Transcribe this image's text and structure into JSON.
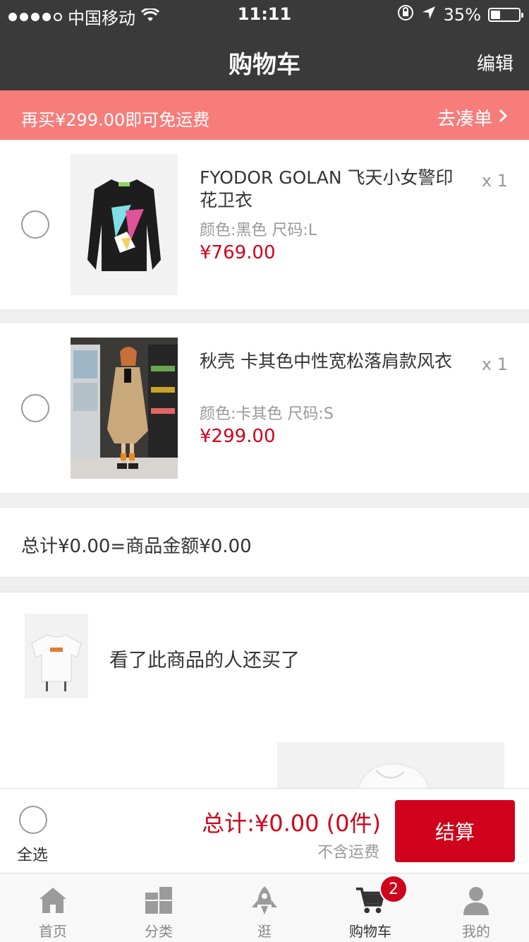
{
  "status_bar": {
    "carrier": "中国移动",
    "time": "11:11",
    "battery": "35%",
    "battery_level": 0.35
  },
  "nav": {
    "title": "购物车",
    "edit_label": "编辑"
  },
  "promo": {
    "message": "再买¥299.00即可免运费",
    "link_label": "去凑单"
  },
  "cart_items": [
    {
      "name": "FYODOR GOLAN  飞天小女警印花卫衣",
      "spec": "颜色:黑色 尺码:L",
      "price": "¥769.00",
      "qty": "x 1"
    },
    {
      "name": "秋壳 卡其色中性宽松落肩款风衣",
      "spec": "颜色:卡其色 尺码:S",
      "price": "¥299.00",
      "qty": "x 1"
    }
  ],
  "summary": {
    "text": "总计¥0.00=商品金额¥0.00"
  },
  "recommend": {
    "title": "看了此商品的人还买了"
  },
  "checkout": {
    "select_all_label": "全选",
    "total_label": "总计:¥0.00 (0件)",
    "shipping_note": "不含运费",
    "pay_label": "结算"
  },
  "tabbar": {
    "items": [
      {
        "label": "首页",
        "icon": "home-icon"
      },
      {
        "label": "分类",
        "icon": "category-icon"
      },
      {
        "label": "逛",
        "icon": "rocket-icon"
      },
      {
        "label": "购物车",
        "icon": "cart-icon",
        "badge": "2"
      },
      {
        "label": "我的",
        "icon": "profile-icon"
      }
    ]
  },
  "colors": {
    "accent": "#d0021b",
    "promo_bg": "#f77d7b",
    "header_bg": "#3a3a3a"
  }
}
